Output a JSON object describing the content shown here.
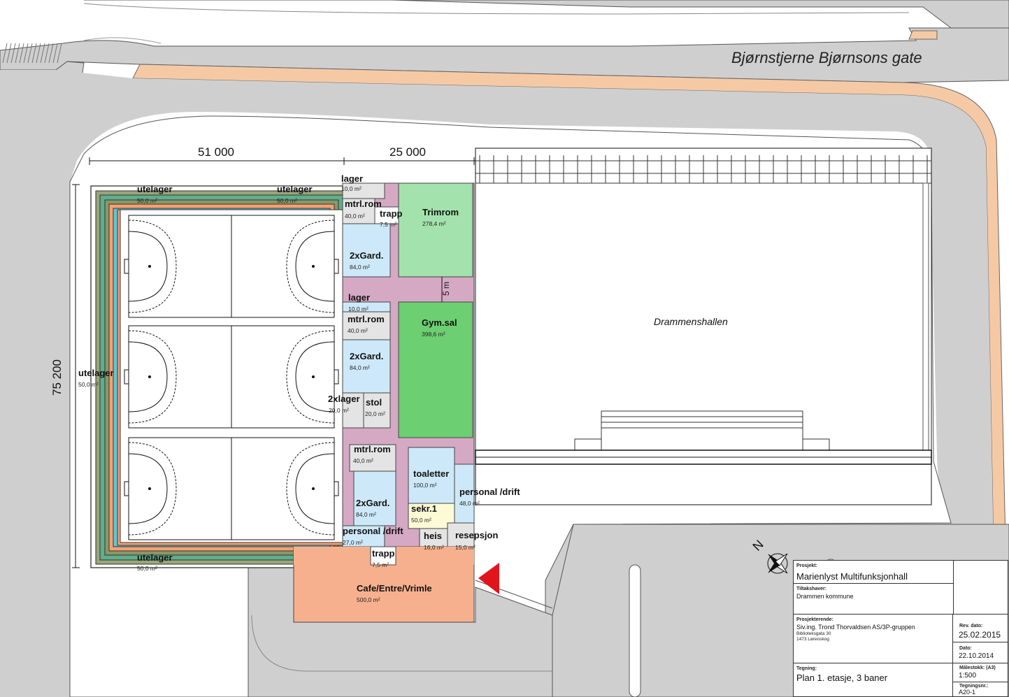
{
  "street_name": "Bjørnstjerne Bjørnsons gate",
  "dimensions": {
    "width_left": "51 000",
    "width_right": "25 000",
    "height": "75 200",
    "corridor": "5 m"
  },
  "rooms": {
    "lager_top": {
      "label": "lager",
      "area": "10,0 m²"
    },
    "mtrl_rom_1": {
      "label": "mtrl.rom",
      "area": "40,0 m²"
    },
    "trapp_top": {
      "label": "trapp",
      "area": "7,5 m²"
    },
    "trimrom": {
      "label": "Trimrom",
      "area": "278,4 m²"
    },
    "gard_1": {
      "label": "2xGard.",
      "area": "84,0 m²"
    },
    "lager_mid": {
      "label": "lager",
      "area": "10,0 m²"
    },
    "mtrl_rom_2": {
      "label": "mtrl.rom",
      "area": "40,0 m²"
    },
    "gymsal": {
      "label": "Gym.sal",
      "area": "398,6 m²"
    },
    "gard_2": {
      "label": "2xGard.",
      "area": "84,0 m²"
    },
    "lager_2x": {
      "label": "2xlager",
      "area": "20,0 m²"
    },
    "stol": {
      "label": "stol",
      "area": "20,0 m²"
    },
    "mtrl_rom_3": {
      "label": "mtrl.rom",
      "area": "40,0 m²"
    },
    "toaletter": {
      "label": "toaletter",
      "area": "100,0 m²"
    },
    "gard_3": {
      "label": "2xGard.",
      "area": "84,0 m²"
    },
    "personal_drift_right": {
      "label": "personal /drift",
      "area": "48,0 m²"
    },
    "sekr": {
      "label": "sekr.1",
      "area": "50,0 m²"
    },
    "personal_drift_left": {
      "label": "personal /drift",
      "area": "27,0 m²"
    },
    "heis": {
      "label": "heis",
      "area": "16,0 m²"
    },
    "resepsjon": {
      "label": "resepsjon",
      "area": "15,0 m²"
    },
    "trapp_bottom": {
      "label": "trapp",
      "area": "7,5 m²"
    },
    "cafe": {
      "label": "Cafe/Entre/Vrimle",
      "area": "500,0 m²"
    },
    "utelager_top_left": {
      "label": "utelager",
      "area": "50,0 m²"
    },
    "utelager_top_right": {
      "label": "utelager",
      "area": "50,0 m²"
    },
    "utelager_left": {
      "label": "utelager",
      "area": "50,0 m²"
    },
    "utelager_bottom": {
      "label": "utelager",
      "area": "50,0 m²"
    }
  },
  "existing_building": "Drammenshallen",
  "north_label": "N",
  "colors": {
    "road": "#cfcfcf",
    "sidewalk": "#f6c9a5",
    "pink_corridor": "#d5a9c3",
    "trimrom": "#a3e2ac",
    "gymsal": "#6ccf72",
    "light_blue": "#cde9f9",
    "grey_room": "#e4e4e4",
    "cafe": "#f7b08e",
    "yellow_room": "#fdfbd6",
    "entrance_arrow": "#e1141c"
  },
  "title_block": {
    "project_label": "Prosjekt:",
    "project": "Marienlyst Multifunksjonhall",
    "owner_label": "Tiltakshaver:",
    "owner": "Drammen kommune",
    "designer_label": "Prosjekterende:",
    "designer": "Siv.ing. Trond Thorvaldsen AS/3P-gruppen",
    "address_1": "Biblioteksgata 30",
    "address_2": "1473 Lørenskog",
    "rev_label": "Rev. dato:",
    "rev_date": "25.02.2015",
    "date_label": "Dato:",
    "date": "22.10.2014",
    "scale_label": "Målestokk: (A3)",
    "scale": "1:500",
    "drawing_label": "Tegning:",
    "drawing": "Plan 1. etasje, 3 baner",
    "drawing_no_label": "Tegningsnr.:",
    "drawing_no": "A20-1"
  }
}
